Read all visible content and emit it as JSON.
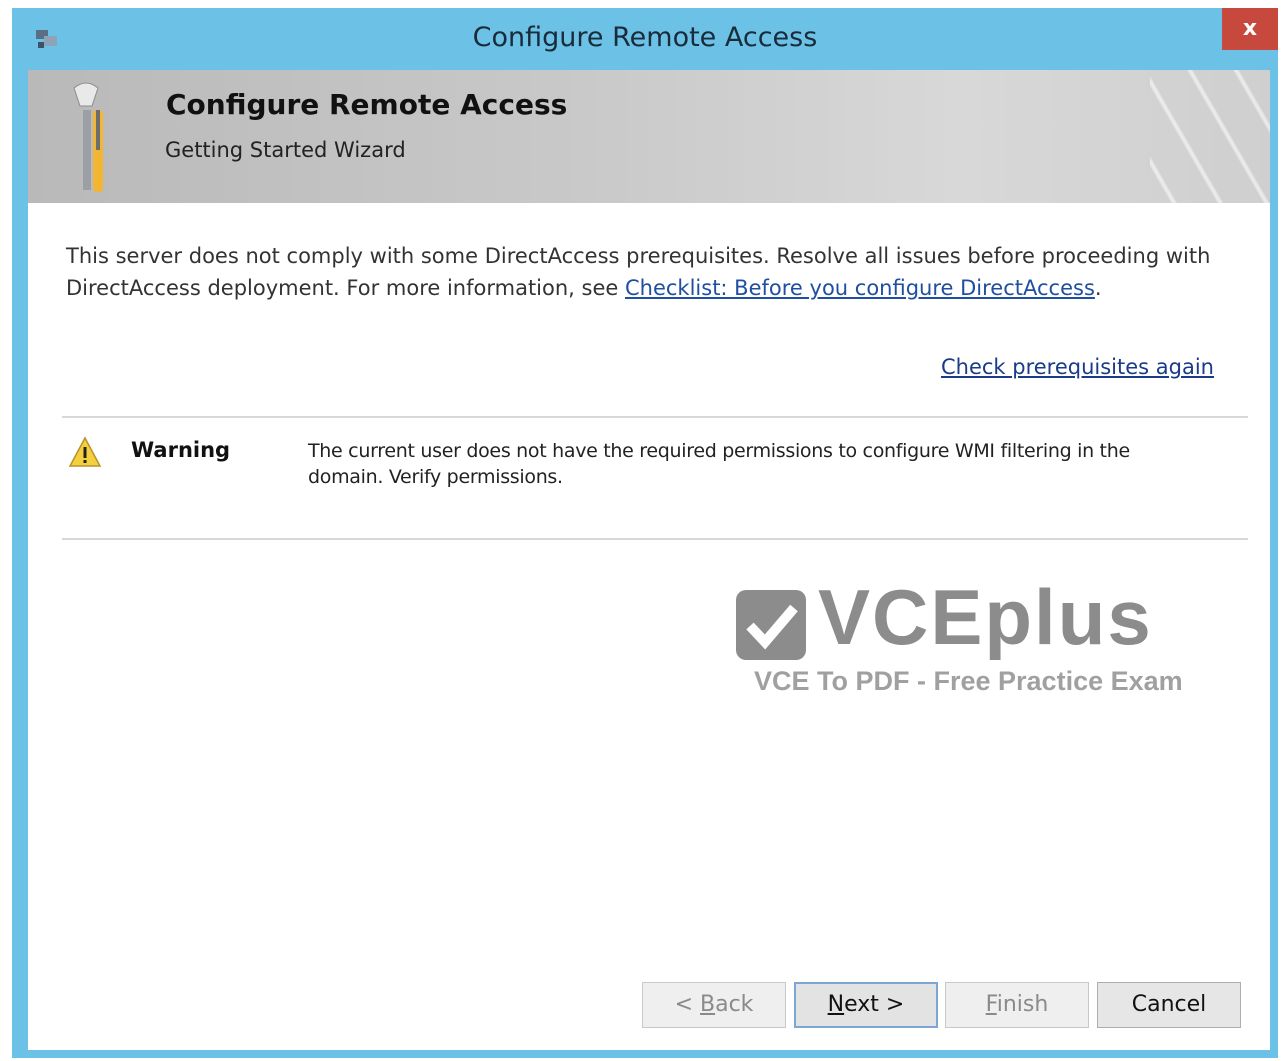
{
  "window": {
    "title": "Configure Remote Access",
    "close_label": "x"
  },
  "header": {
    "title": "Configure Remote Access",
    "subtitle": "Getting Started Wizard"
  },
  "intro": {
    "text": "This server does not comply with some DirectAccess prerequisites. Resolve all issues before proceeding with DirectAccess deployment. For more information, see ",
    "link_label": "Checklist: Before you configure DirectAccess",
    "trailing": "."
  },
  "recheck_link": "Check prerequisites again",
  "warning": {
    "label": "Warning",
    "message": "The current user does not have the required permissions to configure WMI filtering in the domain. Verify permissions."
  },
  "watermark": {
    "brand": "VCEplus",
    "tagline": "VCE To PDF - Free Practice Exam"
  },
  "buttons": {
    "back": {
      "prefix": "< ",
      "mnemonic": "B",
      "rest": "ack"
    },
    "next": {
      "mnemonic": "N",
      "rest": "ext >"
    },
    "finish": {
      "mnemonic": "F",
      "rest": "inish"
    },
    "cancel": "Cancel"
  },
  "colors": {
    "titlebar": "#6cc2e6",
    "close": "#c7483d",
    "link": "#1f4fa0"
  }
}
